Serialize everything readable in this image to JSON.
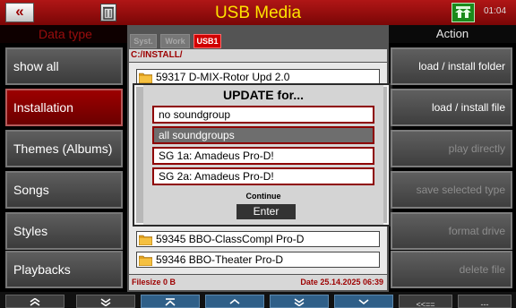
{
  "header": {
    "title": "USB Media",
    "clock": "01:04",
    "back_icon": "back-double-arrow-icon",
    "trash_icon": "trash-icon",
    "status_icon": "dual-arrow-up-icon",
    "title_color": "#ffe300"
  },
  "left_panel": {
    "title": "Data type",
    "items": [
      {
        "label": "show all",
        "active": false
      },
      {
        "label": "Installation",
        "active": true
      },
      {
        "label": "Themes (Albums)",
        "active": false
      },
      {
        "label": "Songs",
        "active": false
      },
      {
        "label": "Styles",
        "active": false
      },
      {
        "label": "Playbacks",
        "active": false
      }
    ]
  },
  "browser": {
    "tabs": [
      {
        "label": "Syst.",
        "active": false
      },
      {
        "label": "Work",
        "active": false
      },
      {
        "label": "USB1",
        "active": true
      }
    ],
    "path": "C:/INSTALL/",
    "files": [
      {
        "name": "59317 D-MIX-Rotor Upd 2.0"
      },
      {
        "name": "59345 BBO-ClassCompl Pro-D"
      },
      {
        "name": "59346 BBO-Theater Pro-D"
      }
    ],
    "filesize": "Filesize 0 B",
    "date": "Date 25.14.2025  06:39"
  },
  "dialog": {
    "title": "UPDATE for...",
    "options": [
      {
        "label": "no soundgroup",
        "selected": false
      },
      {
        "label": "all soundgroups",
        "selected": true
      },
      {
        "label": "SG 1a:  Amadeus Pro-D!",
        "selected": false
      },
      {
        "label": "SG 2a:  Amadeus Pro-D!",
        "selected": false
      }
    ],
    "continue_label": "Continue",
    "enter_label": "Enter"
  },
  "right_panel": {
    "title": "Action",
    "items": [
      {
        "label": "load  /  install folder",
        "enabled": true
      },
      {
        "label": "load  /  install file",
        "enabled": true
      },
      {
        "label": "play directly",
        "enabled": false
      },
      {
        "label": "save selected type",
        "enabled": false
      },
      {
        "label": "format drive",
        "enabled": false
      },
      {
        "label": "delete file",
        "enabled": false
      }
    ]
  },
  "bottom_bar": {
    "buttons": [
      {
        "icon": "double-chevron-up-icon"
      },
      {
        "icon": "double-chevron-down-icon"
      },
      {
        "icon": "page-up-icon"
      },
      {
        "icon": "chevron-up-icon"
      },
      {
        "icon": "double-chevron-down-icon"
      },
      {
        "icon": "chevron-down-icon"
      },
      {
        "label": "<<=="
      },
      {
        "label": "---"
      }
    ]
  },
  "colors": {
    "accent_red": "#b01616",
    "selected_red": "#9c0000",
    "nav_blue": "#2f5f88"
  }
}
